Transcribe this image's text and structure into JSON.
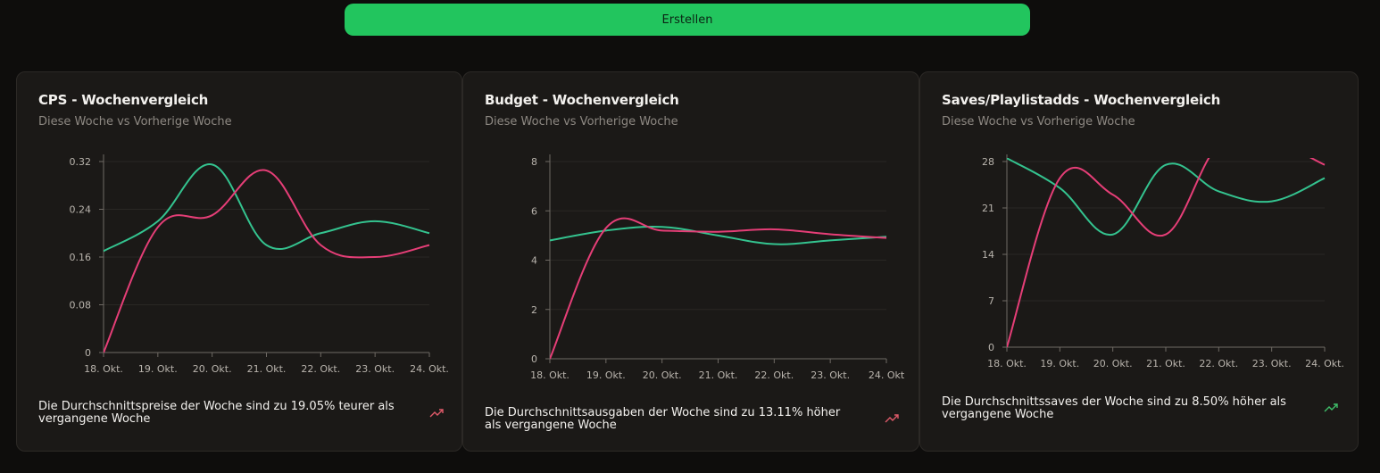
{
  "header": {
    "create_label": "Erstellen"
  },
  "colors": {
    "this_week": "#e53e77",
    "prev_week": "#34c38f",
    "accent": "#22c55e",
    "trend_up_red": "#e05a6a",
    "trend_up_green": "#3fbf6a"
  },
  "cards": [
    {
      "title": "CPS - Wochenvergleich",
      "subtitle": "Diese Woche vs Vorherige Woche",
      "footer": "Die Durchschnittspreise der Woche sind zu 19.05% teurer als vergangene Woche",
      "trend_icon": "trending-up-icon"
    },
    {
      "title": "Budget - Wochenvergleich",
      "subtitle": "Diese Woche vs Vorherige Woche",
      "footer": "Die Durchschnittsausgaben der Woche sind zu 13.11% höher als vergangene Woche",
      "trend_icon": "trending-up-icon"
    },
    {
      "title": "Saves/Playlistadds - Wochenvergleich",
      "subtitle": "Diese Woche vs Vorherige Woche",
      "footer": "Die Durchschnittssaves der Woche sind zu 8.50% höher als vergangene Woche",
      "trend_icon": "trending-up-icon"
    }
  ],
  "chart_data": [
    {
      "type": "line",
      "title": "CPS - Wochenvergleich",
      "x": [
        "18. Okt.",
        "19. Okt.",
        "20. Okt.",
        "21. Okt.",
        "22. Okt.",
        "23. Okt.",
        "24. Okt."
      ],
      "yticks": [
        "0",
        "0.08",
        "0.16",
        "0.24",
        "0.32"
      ],
      "ylim": [
        0,
        0.32
      ],
      "grid": true,
      "series": [
        {
          "values": [
            0,
            0.21,
            0.23,
            0.305,
            0.18,
            0.16,
            0.18
          ],
          "color": "#e53e77"
        },
        {
          "values": [
            0.17,
            0.22,
            0.315,
            0.18,
            0.2,
            0.22,
            0.2
          ],
          "color": "#34c38f"
        }
      ]
    },
    {
      "type": "line",
      "title": "Budget - Wochenvergleich",
      "x": [
        "18. Okt.",
        "19. Okt.",
        "20. Okt.",
        "21. Okt.",
        "22. Okt.",
        "23. Okt.",
        "24. Okt"
      ],
      "yticks": [
        "0",
        "2",
        "4",
        "6",
        "8"
      ],
      "ylim": [
        0,
        8
      ],
      "grid": true,
      "series": [
        {
          "values": [
            0,
            5.3,
            5.2,
            5.15,
            5.25,
            5.05,
            4.9
          ],
          "color": "#e53e77"
        },
        {
          "values": [
            4.8,
            5.2,
            5.35,
            5.0,
            4.65,
            4.8,
            4.95
          ],
          "color": "#34c38f"
        }
      ]
    },
    {
      "type": "line",
      "title": "Saves/Playlistadds - Wochenvergleich",
      "x": [
        "18. Okt.",
        "19. Okt.",
        "20. Okt.",
        "21. Okt.",
        "22. Okt.",
        "23. Okt.",
        "24. Okt."
      ],
      "yticks": [
        "0",
        "7",
        "14",
        "21",
        "28"
      ],
      "ylim": [
        0,
        28
      ],
      "grid": true,
      "series": [
        {
          "values": [
            0,
            25.5,
            23,
            17,
            30.5,
            31,
            27.5
          ],
          "color": "#e53e77"
        },
        {
          "values": [
            28.5,
            24,
            17,
            27.5,
            23.5,
            22,
            25.5
          ],
          "color": "#34c38f"
        }
      ]
    }
  ]
}
